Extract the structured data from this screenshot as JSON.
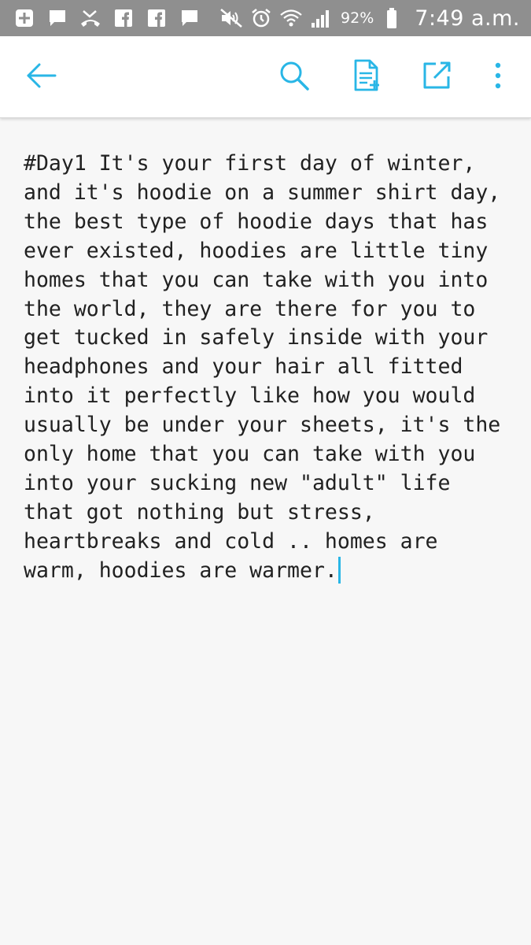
{
  "status_bar": {
    "battery_percent": "92%",
    "time": "7:49 a.m.",
    "icons": [
      "add-box-icon",
      "message-icon",
      "missed-call-icon",
      "facebook-icon",
      "facebook-icon",
      "message-icon",
      "mute-icon",
      "alarm-icon",
      "wifi-icon",
      "signal-icon",
      "battery-icon"
    ]
  },
  "toolbar": {
    "icons": [
      "back-arrow-icon",
      "search-icon",
      "add-note-icon",
      "open-external-icon",
      "more-vert-icon"
    ]
  },
  "colors": {
    "accent": "#29b6e6",
    "status_bar": "#8f8f8f",
    "text": "#212121",
    "background": "#f7f7f7"
  },
  "note": {
    "text": "#Day1 It's your first day of winter, and it's hoodie on a summer shirt day, the best type of hoodie days that has ever existed, hoodies are little tiny homes that you can take with you into the world, they are there for you to get tucked in safely inside with your headphones and your hair all fitted into it perfectly like how you would usually be under your sheets, it's the only home that you can take with you into your sucking new \"adult\" life that got nothing but stress, heartbreaks and cold .. homes are warm, hoodies are warmer."
  }
}
